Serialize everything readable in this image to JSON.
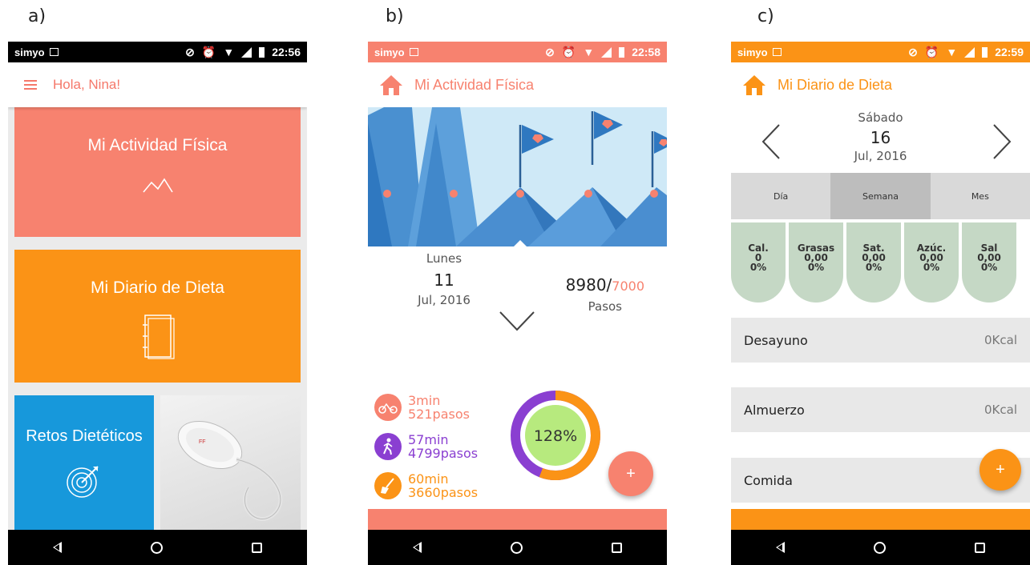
{
  "labels": {
    "a": "a)",
    "b": "b)",
    "c": "c)"
  },
  "colors": {
    "coral": "#f7826f",
    "orange": "#fb9316",
    "blue": "#1798db",
    "purple": "#8a3fd1",
    "green": "#c5d8c5"
  },
  "panel_a": {
    "status": {
      "carrier": "simyo",
      "time": "22:56"
    },
    "header": {
      "title": "Hola, Nina!",
      "menu_icon": "menu-icon"
    },
    "tiles": {
      "actividad": "Mi Actividad Física",
      "dieta": "Mi Diario de Dieta",
      "retos": "Retos Dietéticos"
    }
  },
  "panel_b": {
    "status": {
      "carrier": "simyo",
      "time": "22:58"
    },
    "header": {
      "title": "Mi Actividad Física",
      "icon": "home-icon"
    },
    "date": {
      "weekday": "Lunes",
      "day": "11",
      "month_year": "Jul, 2016"
    },
    "steps": {
      "value": "8980/",
      "goal": "7000",
      "label": "Pasos"
    },
    "activities": [
      {
        "icon": "bike-icon",
        "minutes": "3min",
        "steps": "521pasos",
        "color": "#f7826f"
      },
      {
        "icon": "walk-icon",
        "minutes": "57min",
        "steps": "4799pasos",
        "color": "#8a3fd1"
      },
      {
        "icon": "broom-icon",
        "minutes": "60min",
        "steps": "3660pasos",
        "color": "#fb9316"
      }
    ],
    "progress": {
      "label": "128%",
      "value": 1.28
    },
    "fab": "+"
  },
  "panel_c": {
    "status": {
      "carrier": "simyo",
      "time": "22:59"
    },
    "header": {
      "title": "Mi Diario de Dieta",
      "icon": "home-icon"
    },
    "date": {
      "weekday": "Sábado",
      "day": "16",
      "month_year": "Jul, 2016"
    },
    "tabs": [
      "Día",
      "Semana",
      "Mes"
    ],
    "nutrients": [
      {
        "name": "Cal.",
        "value": "0",
        "pct": "0%"
      },
      {
        "name": "Grasas",
        "value": "0,00",
        "pct": "0%"
      },
      {
        "name": "Sat.",
        "value": "0,00",
        "pct": "0%"
      },
      {
        "name": "Azúc.",
        "value": "0,00",
        "pct": "0%"
      },
      {
        "name": "Sal",
        "value": "0,00",
        "pct": "0%"
      }
    ],
    "meals": [
      {
        "name": "Desayuno",
        "kcal": "0Kcal"
      },
      {
        "name": "Almuerzo",
        "kcal": "0Kcal"
      },
      {
        "name": "Comida",
        "kcal": ""
      }
    ],
    "fab": "+"
  }
}
